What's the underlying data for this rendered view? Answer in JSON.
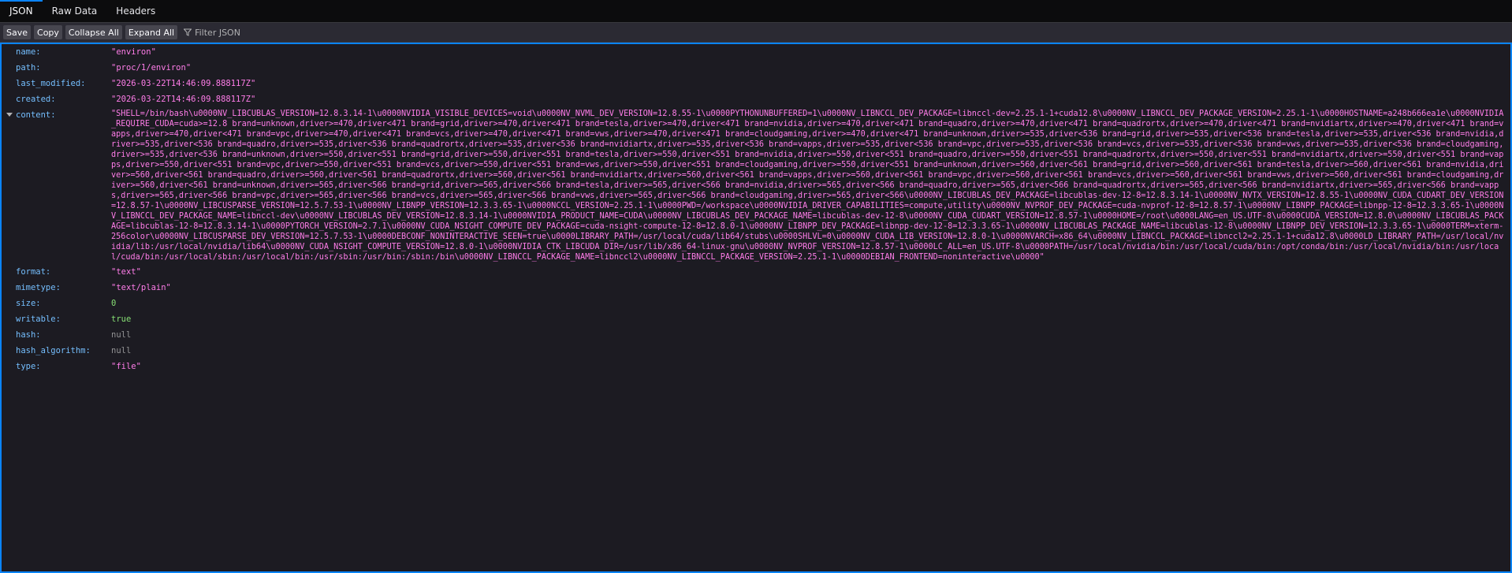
{
  "tabs": [
    {
      "label": "JSON"
    },
    {
      "label": "Raw Data"
    },
    {
      "label": "Headers"
    }
  ],
  "toolbar": {
    "save_label": "Save",
    "copy_label": "Copy",
    "collapse_label": "Collapse All",
    "expand_label": "Expand All",
    "filter_placeholder": "Filter JSON"
  },
  "rows": {
    "name": {
      "key": "name:",
      "value": "\"environ\""
    },
    "path": {
      "key": "path:",
      "value": "\"proc/1/environ\""
    },
    "last_modified": {
      "key": "last_modified:",
      "value": "\"2026-03-22T14:46:09.888117Z\""
    },
    "created": {
      "key": "created:",
      "value": "\"2026-03-22T14:46:09.888117Z\""
    },
    "content": {
      "key": "content:",
      "value": "\"SHELL=/bin/bash\\u0000NV_LIBCUBLAS_VERSION=12.8.3.14-1\\u0000NVIDIA_VISIBLE_DEVICES=void\\u0000NV_NVML_DEV_VERSION=12.8.55-1\\u0000PYTHONUNBUFFERED=1\\u0000NV_LIBNCCL_DEV_PACKAGE=libnccl-dev=2.25.1-1+cuda12.8\\u0000NV_LIBNCCL_DEV_PACKAGE_VERSION=2.25.1-1\\u0000HOSTNAME=a248b666ea1e\\u0000NVIDIA_REQUIRE_CUDA=cuda>=12.8 brand=unknown,driver>=470,driver<471 brand=grid,driver>=470,driver<471 brand=tesla,driver>=470,driver<471 brand=nvidia,driver>=470,driver<471 brand=quadro,driver>=470,driver<471 brand=quadrortx,driver>=470,driver<471 brand=nvidiartx,driver>=470,driver<471 brand=vapps,driver>=470,driver<471 brand=vpc,driver>=470,driver<471 brand=vcs,driver>=470,driver<471 brand=vws,driver>=470,driver<471 brand=cloudgaming,driver>=470,driver<471 brand=unknown,driver>=535,driver<536 brand=grid,driver>=535,driver<536 brand=tesla,driver>=535,driver<536 brand=nvidia,driver>=535,driver<536 brand=quadro,driver>=535,driver<536 brand=quadrortx,driver>=535,driver<536 brand=nvidiartx,driver>=535,driver<536 brand=vapps,driver>=535,driver<536 brand=vpc,driver>=535,driver<536 brand=vcs,driver>=535,driver<536 brand=vws,driver>=535,driver<536 brand=cloudgaming,driver>=535,driver<536 brand=unknown,driver>=550,driver<551 brand=grid,driver>=550,driver<551 brand=tesla,driver>=550,driver<551 brand=nvidia,driver>=550,driver<551 brand=quadro,driver>=550,driver<551 brand=quadrortx,driver>=550,driver<551 brand=nvidiartx,driver>=550,driver<551 brand=vapps,driver>=550,driver<551 brand=vpc,driver>=550,driver<551 brand=vcs,driver>=550,driver<551 brand=vws,driver>=550,driver<551 brand=cloudgaming,driver>=550,driver<551 brand=unknown,driver>=560,driver<561 brand=grid,driver>=560,driver<561 brand=tesla,driver>=560,driver<561 brand=nvidia,driver>=560,driver<561 brand=quadro,driver>=560,driver<561 brand=quadrortx,driver>=560,driver<561 brand=nvidiartx,driver>=560,driver<561 brand=vapps,driver>=560,driver<561 brand=vpc,driver>=560,driver<561 brand=vcs,driver>=560,driver<561 brand=vws,driver>=560,driver<561 brand=cloudgaming,driver>=560,driver<561 brand=unknown,driver>=565,driver<566 brand=grid,driver>=565,driver<566 brand=tesla,driver>=565,driver<566 brand=nvidia,driver>=565,driver<566 brand=quadro,driver>=565,driver<566 brand=quadrortx,driver>=565,driver<566 brand=nvidiartx,driver>=565,driver<566 brand=vapps,driver>=565,driver<566 brand=vpc,driver>=565,driver<566 brand=vcs,driver>=565,driver<566 brand=vws,driver>=565,driver<566 brand=cloudgaming,driver>=565,driver<566\\u0000NV_LIBCUBLAS_DEV_PACKAGE=libcublas-dev-12-8=12.8.3.14-1\\u0000NV_NVTX_VERSION=12.8.55-1\\u0000NV_CUDA_CUDART_DEV_VERSION=12.8.57-1\\u0000NV_LIBCUSPARSE_VERSION=12.5.7.53-1\\u0000NV_LIBNPP_VERSION=12.3.3.65-1\\u0000NCCL_VERSION=2.25.1-1\\u0000PWD=/workspace\\u0000NVIDIA_DRIVER_CAPABILITIES=compute,utility\\u0000NV_NVPROF_DEV_PACKAGE=cuda-nvprof-12-8=12.8.57-1\\u0000NV_LIBNPP_PACKAGE=libnpp-12-8=12.3.3.65-1\\u0000NV_LIBNCCL_DEV_PACKAGE_NAME=libnccl-dev\\u0000NV_LIBCUBLAS_DEV_VERSION=12.8.3.14-1\\u0000NVIDIA_PRODUCT_NAME=CUDA\\u0000NV_LIBCUBLAS_DEV_PACKAGE_NAME=libcublas-dev-12-8\\u0000NV_CUDA_CUDART_VERSION=12.8.57-1\\u0000HOME=/root\\u0000LANG=en_US.UTF-8\\u0000CUDA_VERSION=12.8.0\\u0000NV_LIBCUBLAS_PACKAGE=libcublas-12-8=12.8.3.14-1\\u0000PYTORCH_VERSION=2.7.1\\u0000NV_CUDA_NSIGHT_COMPUTE_DEV_PACKAGE=cuda-nsight-compute-12-8=12.8.0-1\\u0000NV_LIBNPP_DEV_PACKAGE=libnpp-dev-12-8=12.3.3.65-1\\u0000NV_LIBCUBLAS_PACKAGE_NAME=libcublas-12-8\\u0000NV_LIBNPP_DEV_VERSION=12.3.3.65-1\\u0000TERM=xterm-256color\\u0000NV_LIBCUSPARSE_DEV_VERSION=12.5.7.53-1\\u0000DEBCONF_NONINTERACTIVE_SEEN=true\\u0000LIBRARY_PATH=/usr/local/cuda/lib64/stubs\\u0000SHLVL=0\\u0000NV_CUDA_LIB_VERSION=12.8.0-1\\u0000NVARCH=x86_64\\u0000NV_LIBNCCL_PACKAGE=libnccl2=2.25.1-1+cuda12.8\\u0000LD_LIBRARY_PATH=/usr/local/nvidia/lib:/usr/local/nvidia/lib64\\u0000NV_CUDA_NSIGHT_COMPUTE_VERSION=12.8.0-1\\u0000NVIDIA_CTK_LIBCUDA_DIR=/usr/lib/x86_64-linux-gnu\\u0000NV_NVPROF_VERSION=12.8.57-1\\u0000LC_ALL=en_US.UTF-8\\u0000PATH=/usr/local/nvidia/bin:/usr/local/cuda/bin:/opt/conda/bin:/usr/local/nvidia/bin:/usr/local/cuda/bin:/usr/local/sbin:/usr/local/bin:/usr/sbin:/usr/bin:/sbin:/bin\\u0000NV_LIBNCCL_PACKAGE_NAME=libnccl2\\u0000NV_LIBNCCL_PACKAGE_VERSION=2.25.1-1\\u0000DEBIAN_FRONTEND=noninteractive\\u0000\""
    },
    "format": {
      "key": "format:",
      "value": "\"text\""
    },
    "mimetype": {
      "key": "mimetype:",
      "value": "\"text/plain\""
    },
    "size": {
      "key": "size:",
      "value": "0"
    },
    "writable": {
      "key": "writable:",
      "value": "true"
    },
    "hash": {
      "key": "hash:",
      "value": "null"
    },
    "hash_algorithm": {
      "key": "hash_algorithm:",
      "value": "null"
    },
    "type": {
      "key": "type:",
      "value": "\"file\""
    }
  },
  "colors": {
    "accent": "#0a84ff",
    "key": "#75bfff",
    "string": "#ff7de9",
    "number": "#86de74",
    "null": "#939395"
  },
  "icons": {
    "filter": "filter-icon",
    "twisty": "expand-twisty-icon"
  }
}
